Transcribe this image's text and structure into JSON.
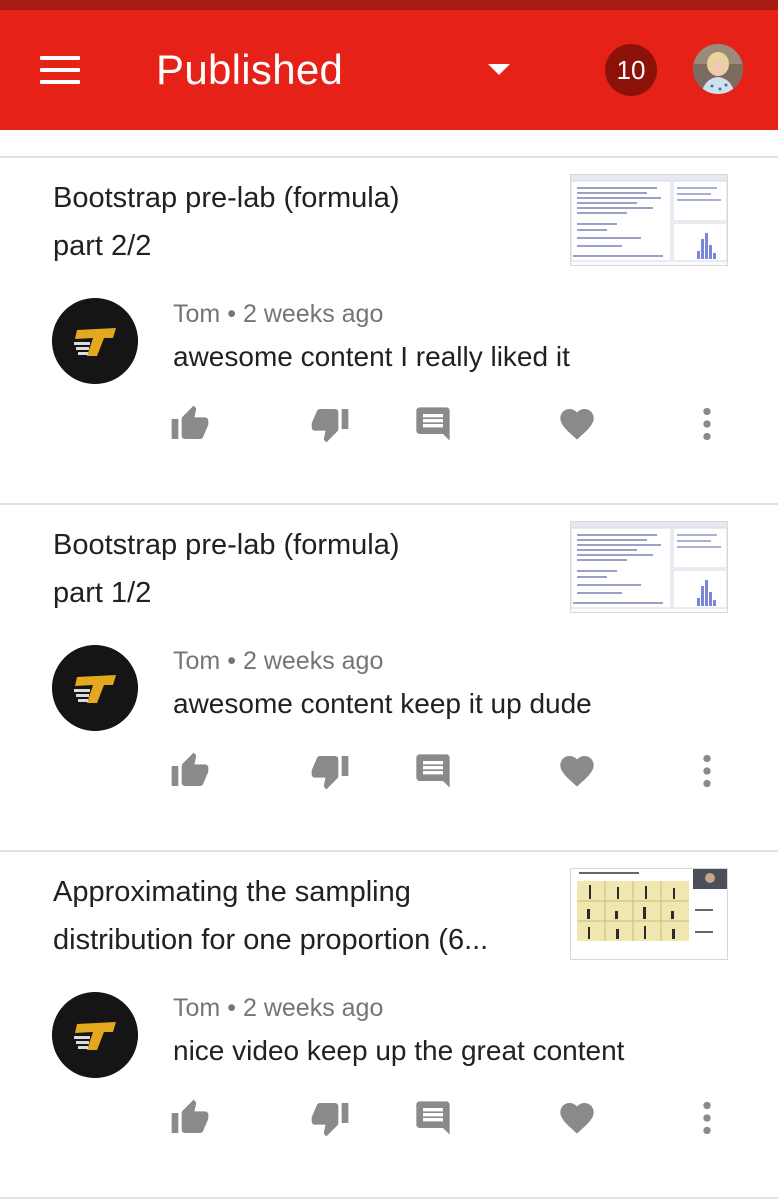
{
  "header": {
    "title": "Published",
    "notification_count": "10",
    "menu_icon": "hamburger-menu-icon",
    "dropdown_icon": "arrow-drop-down-icon",
    "accent_color": "#e62117"
  },
  "comments": [
    {
      "video_title_line1": "Bootstrap pre-lab (formula)",
      "video_title_line2": "part 2/2",
      "author": "Tom",
      "separator": "•",
      "time": "2 weeks ago",
      "text": "awesome content I really liked it"
    },
    {
      "video_title_line1": "Bootstrap pre-lab (formula)",
      "video_title_line2": "part 1/2",
      "author": "Tom",
      "separator": "•",
      "time": "2 weeks ago",
      "text": "awesome content keep it up dude"
    },
    {
      "video_title_line1": "Approximating the sampling",
      "video_title_line2": "distribution for one proportion  (6...",
      "author": "Tom",
      "separator": "•",
      "time": "2 weeks ago",
      "text": "nice video keep up the great content"
    }
  ],
  "actions": [
    "thumb-up-icon",
    "thumb-down-icon",
    "reply-icon",
    "heart-icon",
    "more-vert-icon"
  ]
}
